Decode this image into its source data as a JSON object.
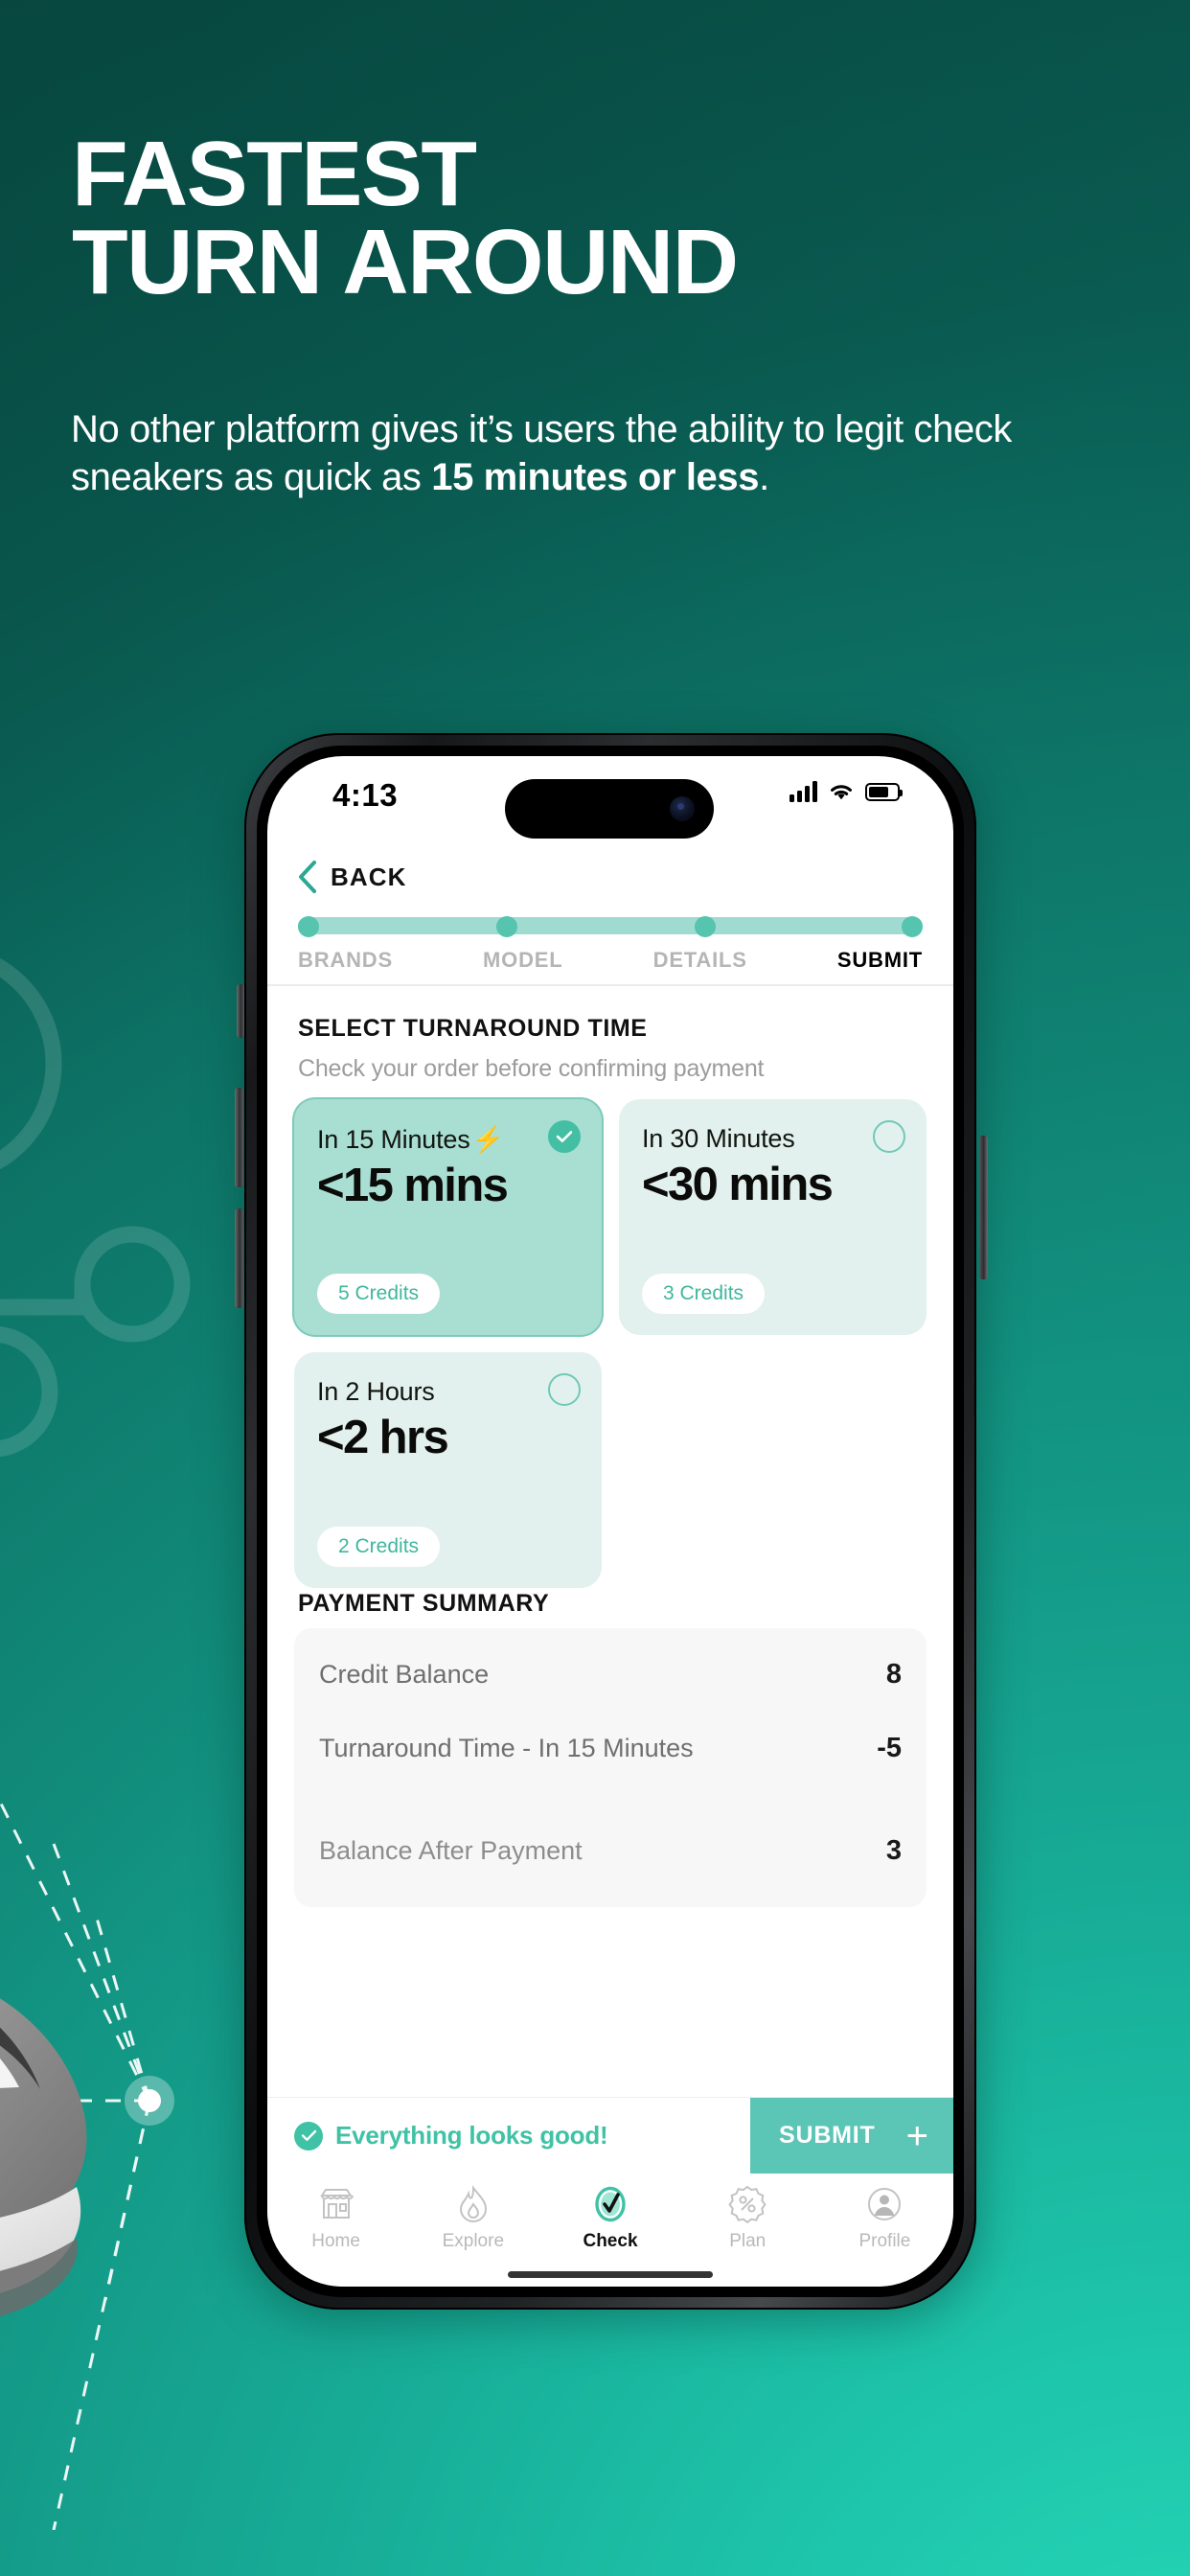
{
  "promo": {
    "headline_line1": "FASTEST",
    "headline_line2": "TURN AROUND",
    "subtitle_plain_1": "No other platform gives it’s users the ability to legit check sneakers as quick as ",
    "subtitle_bold": "15 minutes or less",
    "subtitle_plain_2": "."
  },
  "colors": {
    "brand_teal": "#3fc2a5",
    "accent_mint": "#5cc6b6",
    "card_selected": "#a9ded3",
    "card_unselected": "#e2f1ee",
    "bg_dark": "#0a544c",
    "bg_light": "#27d9b8"
  },
  "phone": {
    "status_bar": {
      "time": "4:13",
      "cellular_icon": "signal-bars-icon",
      "wifi_icon": "wifi-icon",
      "battery_icon": "battery-icon"
    },
    "header": {
      "back_icon": "chevron-left-icon",
      "back_label": "BACK"
    },
    "stepper": {
      "steps": [
        {
          "label": "BRANDS",
          "active": false
        },
        {
          "label": "MODEL",
          "active": false
        },
        {
          "label": "DETAILS",
          "active": false
        },
        {
          "label": "SUBMIT",
          "active": true
        }
      ]
    },
    "section": {
      "title": "SELECT TURNAROUND TIME",
      "subtitle": "Check your order before confirming payment"
    },
    "turnaround_options": [
      {
        "title": "In 15 Minutes",
        "bolt": "⚡",
        "has_bolt": true,
        "headline": "<15 mins",
        "credits": "5 Credits",
        "selected": true,
        "radio_icon": "radio-checked-icon"
      },
      {
        "title": "In 30 Minutes",
        "bolt": "",
        "has_bolt": false,
        "headline": "<30 mins",
        "credits": "3 Credits",
        "selected": false,
        "radio_icon": "radio-unchecked-icon"
      },
      {
        "title": "In 2 Hours",
        "bolt": "",
        "has_bolt": false,
        "headline": "<2 hrs",
        "credits": "2 Credits",
        "selected": false,
        "radio_icon": "radio-unchecked-icon"
      }
    ],
    "payment_summary": {
      "title": "PAYMENT SUMMARY",
      "rows": [
        {
          "label": "Credit Balance",
          "value": "8"
        },
        {
          "label": "Turnaround Time - In 15 Minutes",
          "value": "-5"
        },
        {
          "label": "Balance After Payment",
          "value": "3"
        }
      ]
    },
    "action_bar": {
      "status_icon": "check-circle-icon",
      "status_text": "Everything looks good!",
      "submit_label": "SUBMIT",
      "submit_plus": "+"
    },
    "tab_bar": {
      "tabs": [
        {
          "label": "Home",
          "icon": "storefront-icon",
          "active": false
        },
        {
          "label": "Explore",
          "icon": "flame-icon",
          "active": false
        },
        {
          "label": "Check",
          "icon": "check-badge-icon",
          "active": true
        },
        {
          "label": "Plan",
          "icon": "percent-badge-icon",
          "active": false
        },
        {
          "label": "Profile",
          "icon": "user-circle-icon",
          "active": false
        }
      ]
    }
  }
}
